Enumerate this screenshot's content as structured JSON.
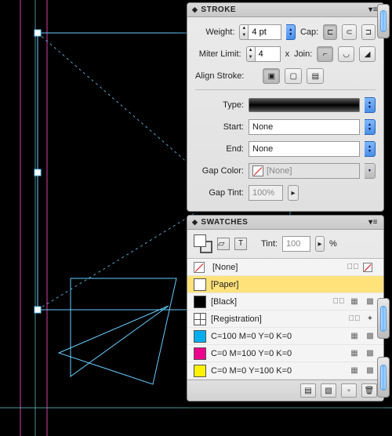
{
  "stroke": {
    "title": "STROKE",
    "weight_label": "Weight:",
    "weight_value": "4 pt",
    "cap_label": "Cap:",
    "miter_label": "Miter Limit:",
    "miter_value": "4",
    "miter_x": "x",
    "join_label": "Join:",
    "align_label": "Align Stroke:",
    "type_label": "Type:",
    "start_label": "Start:",
    "start_value": "None",
    "end_label": "End:",
    "end_value": "None",
    "gapcolor_label": "Gap Color:",
    "gapcolor_value": "[None]",
    "gaptint_label": "Gap Tint:",
    "gaptint_value": "100%"
  },
  "swatches": {
    "title": "SWATCHES",
    "tint_label": "Tint:",
    "tint_value": "100",
    "tint_pct": "%",
    "items": [
      {
        "name": "[None]",
        "chip": "none",
        "locked": true,
        "nonedit": true,
        "proc": false
      },
      {
        "name": "[Paper]",
        "chip": "paper",
        "selected": true
      },
      {
        "name": "[Black]",
        "chip": "black",
        "locked": true,
        "proc": true
      },
      {
        "name": "[Registration]",
        "chip": "reg",
        "locked": true,
        "regmark": true
      },
      {
        "name": "C=100 M=0 Y=0 K=0",
        "chip": "cyan",
        "proc": true
      },
      {
        "name": "C=0 M=100 Y=0 K=0",
        "chip": "mag",
        "proc": true
      },
      {
        "name": "C=0 M=0 Y=100 K=0",
        "chip": "yel",
        "proc": true
      }
    ]
  }
}
